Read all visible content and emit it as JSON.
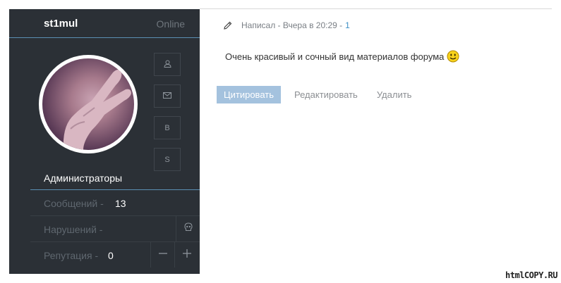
{
  "profile": {
    "username": "st1mul",
    "status": "Online",
    "group": "Администраторы",
    "side_buttons": [
      {
        "icon": "user-icon",
        "label": ""
      },
      {
        "icon": "mail-icon",
        "label": ""
      },
      {
        "icon": "",
        "label": "B"
      },
      {
        "icon": "",
        "label": "S"
      }
    ],
    "stats": {
      "messages_label": "Сообщений -",
      "messages_value": "13",
      "violations_label": "Нарушений -",
      "reputation_label": "Репутация -",
      "reputation_value": "0"
    }
  },
  "post": {
    "meta_prefix": "Написал - Вчера в 20:29 -",
    "post_number": "1",
    "text": "Очень красивый и сочный вид материалов форума",
    "actions": {
      "quote": "Цитировать",
      "edit": "Редактировать",
      "delete": "Удалить"
    }
  },
  "watermark": "htmlCOPY.RU",
  "colors": {
    "panel_bg": "#2b3036",
    "accent_line": "#5b8fb3",
    "quote_button": "#a4c2de",
    "link_number": "#3e8fc5"
  }
}
